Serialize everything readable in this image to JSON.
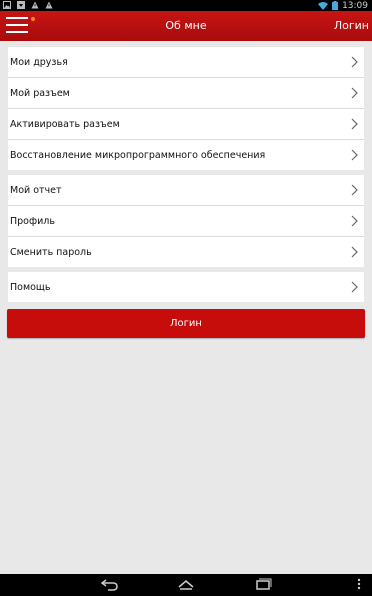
{
  "status_bar": {
    "time": "13:09",
    "left_icons": [
      "image-icon",
      "download-icon",
      "warning-icon",
      "warning-icon"
    ],
    "right_icons": [
      "wifi-icon",
      "battery-icon"
    ]
  },
  "toolbar": {
    "title": "Об мне",
    "action_label": "Логин",
    "background_color": "#b50f0f",
    "badge_color": "#ff8a1e"
  },
  "groups": [
    {
      "items": [
        {
          "label": "Мои друзья"
        },
        {
          "label": "Мой разъем"
        },
        {
          "label": "Активировать разъем"
        },
        {
          "label": "Восстановление микропрограммного обеспечения"
        }
      ]
    },
    {
      "items": [
        {
          "label": "Мой отчет"
        },
        {
          "label": "Профиль"
        },
        {
          "label": "Сменить пароль"
        }
      ]
    },
    {
      "items": [
        {
          "label": "Помощь"
        }
      ]
    }
  ],
  "login_button": {
    "label": "Логин",
    "color": "#c70c0c"
  },
  "nav_bar": {
    "icons": [
      "back-icon",
      "home-icon",
      "recent-apps-icon",
      "overflow-menu-icon"
    ]
  }
}
